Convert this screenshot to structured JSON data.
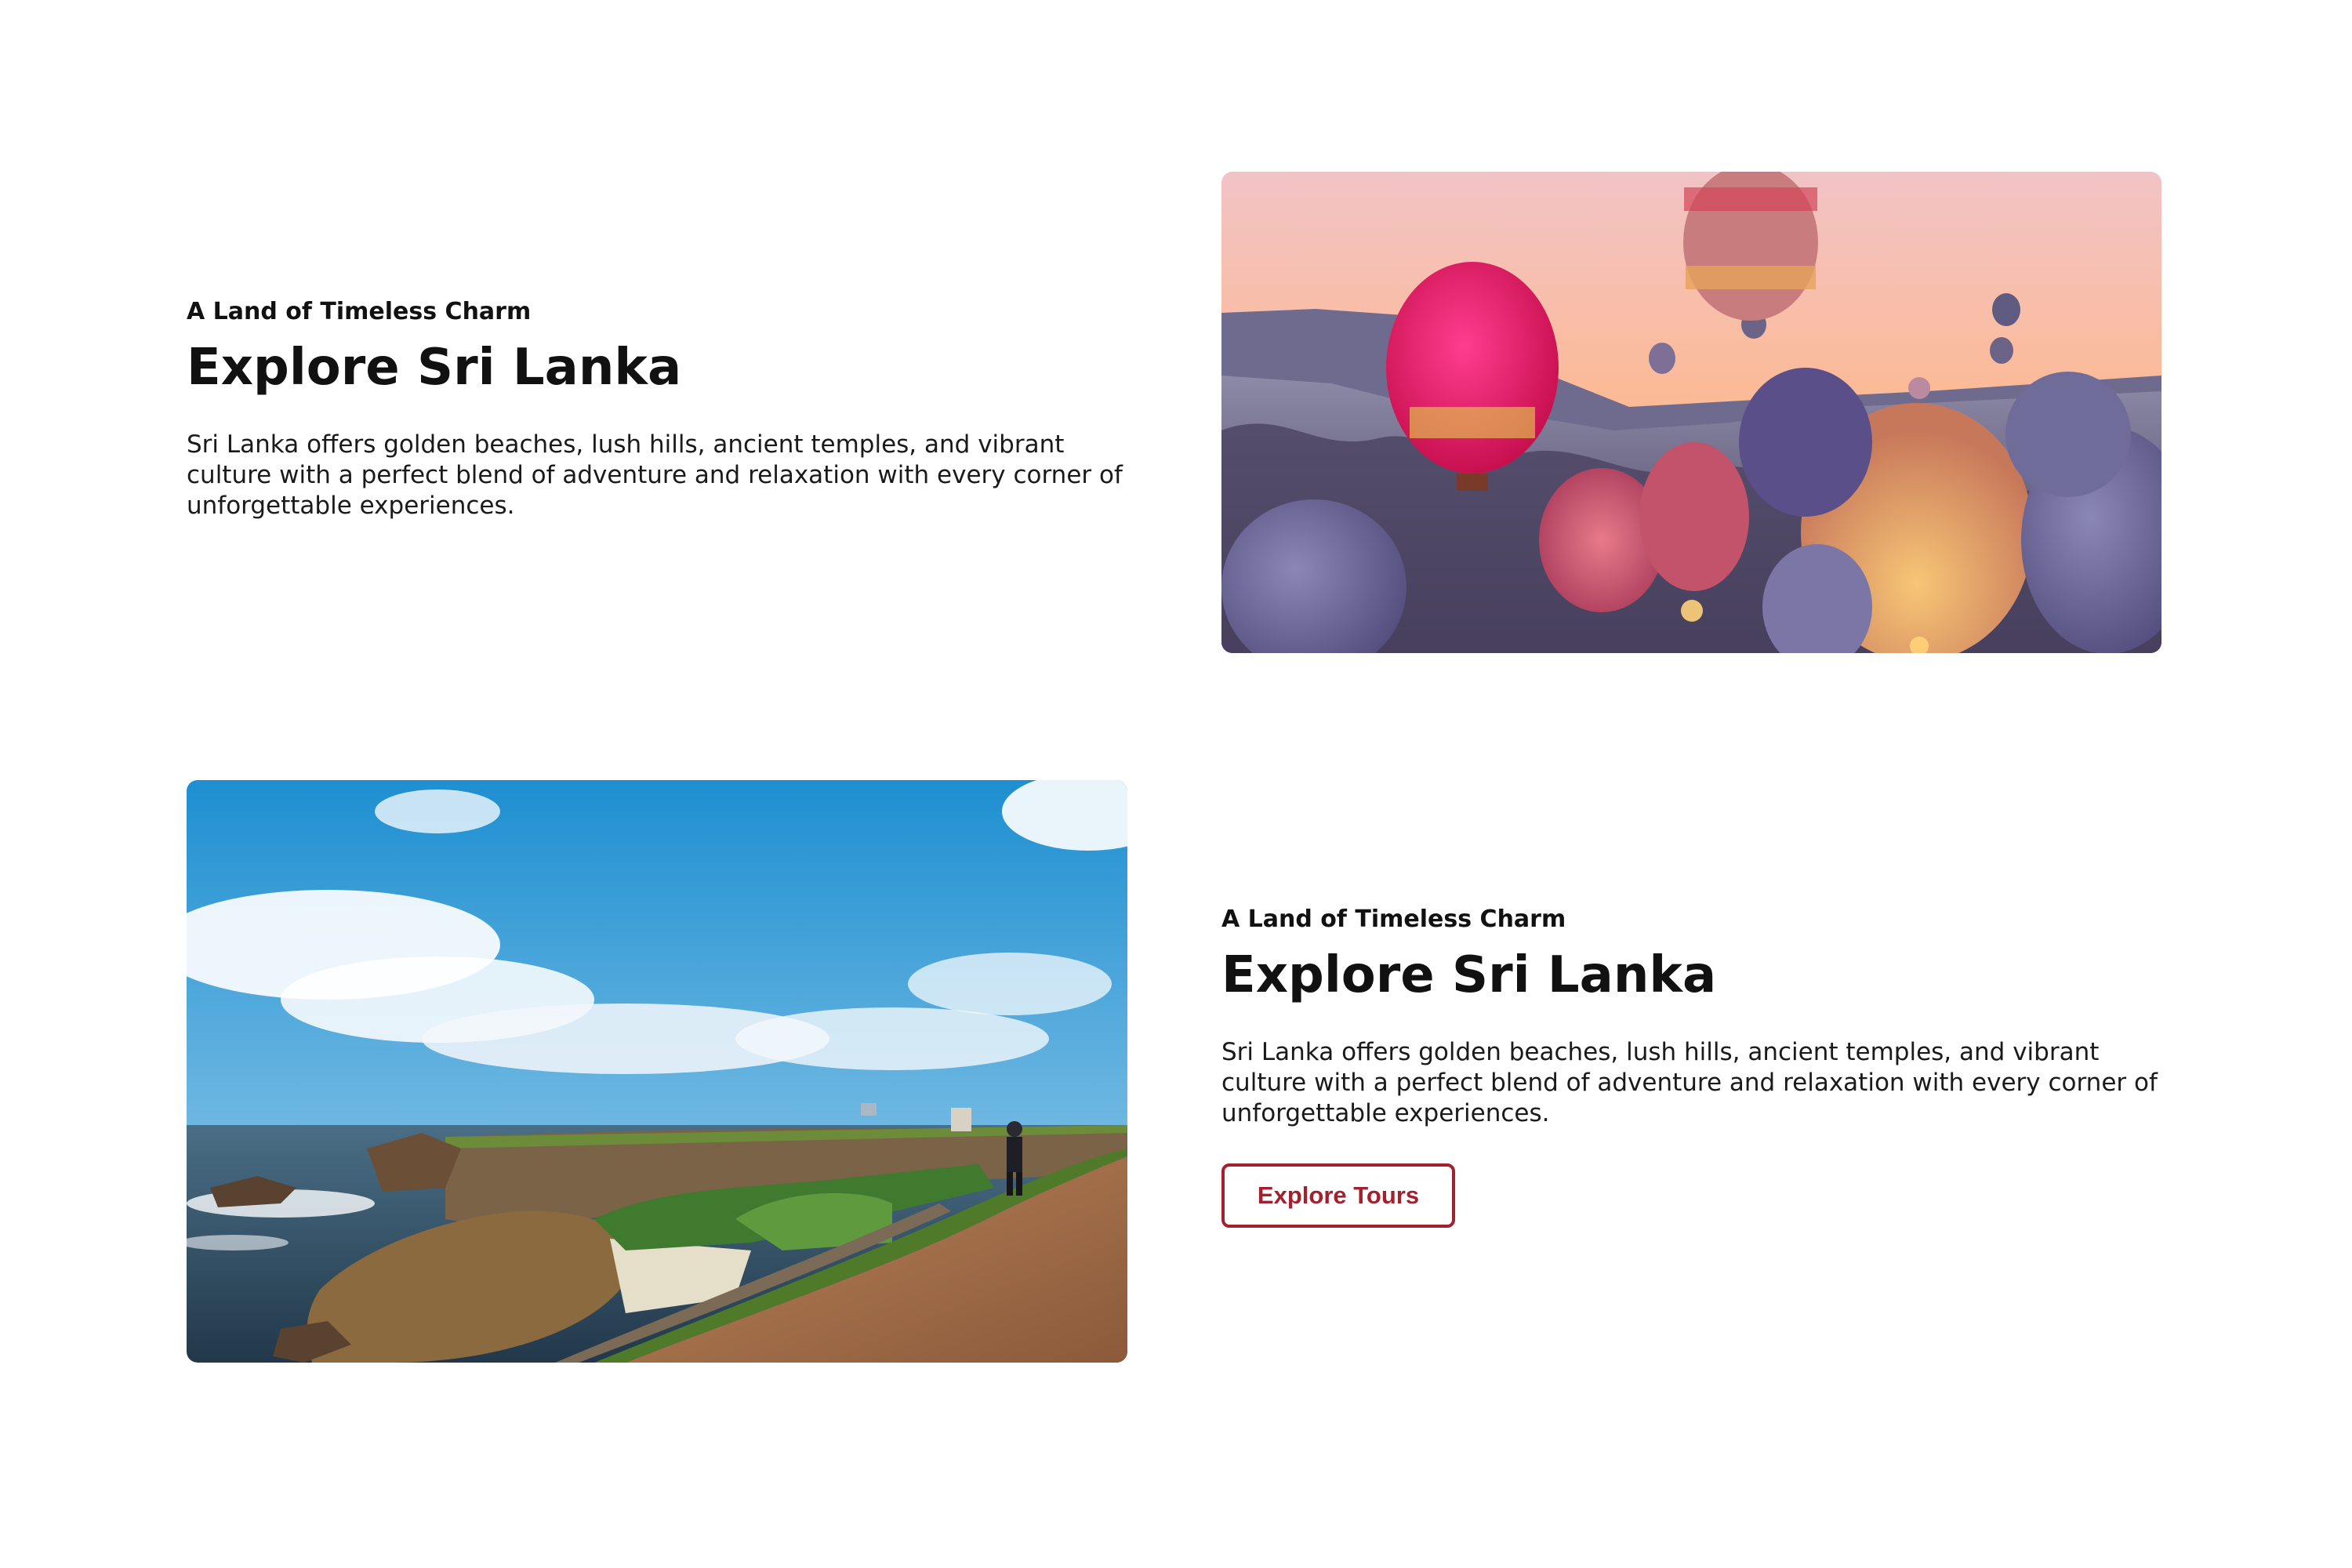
{
  "row1": {
    "eyebrow": "A Land of Timeless Charm",
    "title": "Explore Sri Lanka",
    "description": "Sri Lanka offers golden beaches, lush hills, ancient temples, and vibrant culture with a perfect blend of adventure and relaxation with every corner of unforgettable experiences.",
    "image_subject": "hot air balloons at sunrise"
  },
  "row2": {
    "eyebrow": "A Land of Timeless Charm",
    "title": "Explore Sri Lanka",
    "description": "Sri Lanka offers golden beaches, lush hills, ancient temples, and vibrant culture with a perfect blend of adventure and relaxation with every corner of unforgettable experiences.",
    "button_label": "Explore Tours",
    "image_subject": "coastal fort path by the sea"
  },
  "colors": {
    "accent": "#a3212e",
    "text": "#111111",
    "background": "#ffffff"
  }
}
